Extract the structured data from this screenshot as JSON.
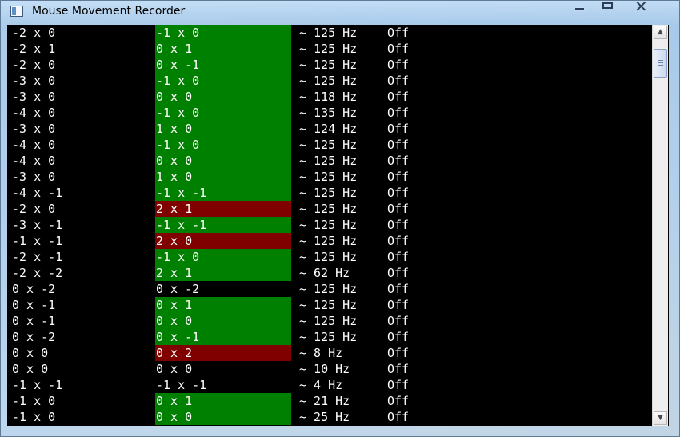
{
  "window": {
    "title": "Mouse Movement Recorder",
    "icon": "app-window-icon",
    "controls": {
      "minimize_icon": "minimize-icon",
      "maximize_icon": "maximize-icon",
      "close_icon": "close-icon",
      "close_glyph": "✕"
    }
  },
  "colors": {
    "green": "#008000",
    "red": "#800000",
    "background": "#000000",
    "text": "#ffffff"
  },
  "scrollbar": {
    "up_glyph": "▲",
    "down_glyph": "▼"
  },
  "rows": [
    {
      "raw": "-2 x 0",
      "filtered": "-1 x 0",
      "status": "green",
      "rate": "~ 125 Hz",
      "state": "Off"
    },
    {
      "raw": "-2 x 1",
      "filtered": "0 x 1",
      "status": "green",
      "rate": "~ 125 Hz",
      "state": "Off"
    },
    {
      "raw": "-2 x 0",
      "filtered": "0 x -1",
      "status": "green",
      "rate": "~ 125 Hz",
      "state": "Off"
    },
    {
      "raw": "-3 x 0",
      "filtered": "-1 x 0",
      "status": "green",
      "rate": "~ 125 Hz",
      "state": "Off"
    },
    {
      "raw": "-3 x 0",
      "filtered": "0 x 0",
      "status": "green",
      "rate": "~ 118 Hz",
      "state": "Off"
    },
    {
      "raw": "-4 x 0",
      "filtered": "-1 x 0",
      "status": "green",
      "rate": "~ 135 Hz",
      "state": "Off"
    },
    {
      "raw": "-3 x 0",
      "filtered": "1 x 0",
      "status": "green",
      "rate": "~ 124 Hz",
      "state": "Off"
    },
    {
      "raw": "-4 x 0",
      "filtered": "-1 x 0",
      "status": "green",
      "rate": "~ 125 Hz",
      "state": "Off"
    },
    {
      "raw": "-4 x 0",
      "filtered": "0 x 0",
      "status": "green",
      "rate": "~ 125 Hz",
      "state": "Off"
    },
    {
      "raw": "-3 x 0",
      "filtered": "1 x 0",
      "status": "green",
      "rate": "~ 125 Hz",
      "state": "Off"
    },
    {
      "raw": "-4 x -1",
      "filtered": "-1 x -1",
      "status": "green",
      "rate": "~ 125 Hz",
      "state": "Off"
    },
    {
      "raw": "-2 x 0",
      "filtered": "2 x 1",
      "status": "red",
      "rate": "~ 125 Hz",
      "state": "Off"
    },
    {
      "raw": "-3 x -1",
      "filtered": "-1 x -1",
      "status": "green",
      "rate": "~ 125 Hz",
      "state": "Off"
    },
    {
      "raw": "-1 x -1",
      "filtered": "2 x 0",
      "status": "red",
      "rate": "~ 125 Hz",
      "state": "Off"
    },
    {
      "raw": "-2 x -1",
      "filtered": "-1 x 0",
      "status": "green",
      "rate": "~ 125 Hz",
      "state": "Off"
    },
    {
      "raw": "-2 x -2",
      "filtered": "2 x 1",
      "status": "green",
      "rate": "~ 62 Hz",
      "state": "Off"
    },
    {
      "raw": "0 x -2",
      "filtered": "0 x -2",
      "status": "none",
      "rate": "~ 125 Hz",
      "state": "Off"
    },
    {
      "raw": "0 x -1",
      "filtered": "0 x 1",
      "status": "green",
      "rate": "~ 125 Hz",
      "state": "Off"
    },
    {
      "raw": "0 x -1",
      "filtered": "0 x 0",
      "status": "green",
      "rate": "~ 125 Hz",
      "state": "Off"
    },
    {
      "raw": "0 x -2",
      "filtered": "0 x -1",
      "status": "green",
      "rate": "~ 125 Hz",
      "state": "Off"
    },
    {
      "raw": "0 x 0",
      "filtered": "0 x 2",
      "status": "red",
      "rate": "~ 8 Hz",
      "state": "Off"
    },
    {
      "raw": "0 x 0",
      "filtered": "0 x 0",
      "status": "none",
      "rate": "~ 10 Hz",
      "state": "Off"
    },
    {
      "raw": "-1 x -1",
      "filtered": "-1 x -1",
      "status": "none",
      "rate": "~ 4 Hz",
      "state": "Off"
    },
    {
      "raw": "-1 x 0",
      "filtered": "0 x 1",
      "status": "green",
      "rate": "~ 21 Hz",
      "state": "Off"
    },
    {
      "raw": "-1 x 0",
      "filtered": "0 x 0",
      "status": "green",
      "rate": "~ 25 Hz",
      "state": "Off"
    }
  ]
}
